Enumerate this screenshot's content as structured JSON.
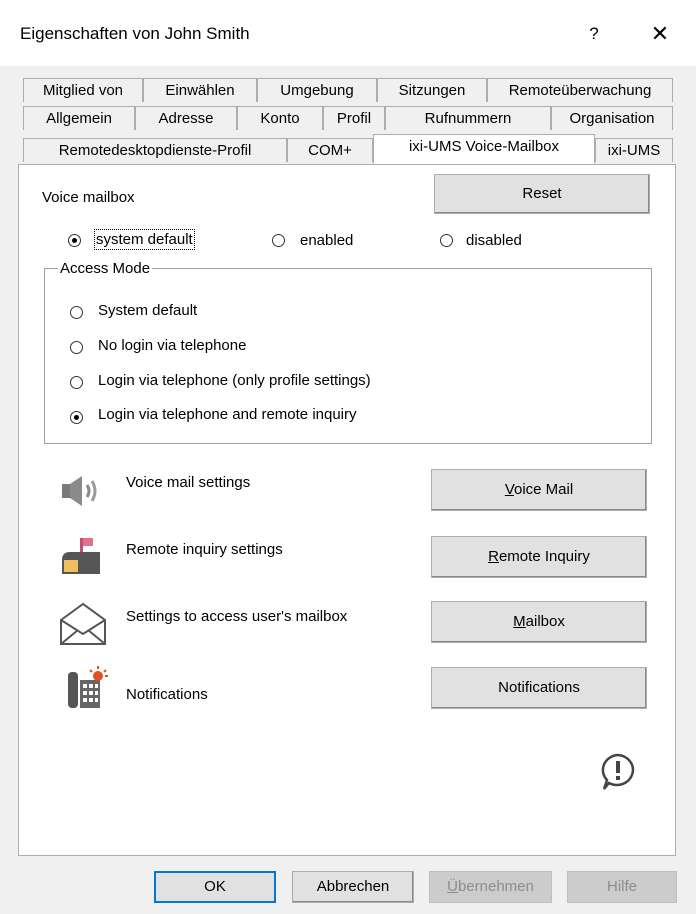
{
  "window": {
    "title": "Eigenschaften von John Smith",
    "help": "?",
    "close": "✕"
  },
  "tabs": {
    "row1": [
      "Mitglied von",
      "Einwählen",
      "Umgebung",
      "Sitzungen",
      "Remoteüberwachung"
    ],
    "row2": [
      "Allgemein",
      "Adresse",
      "Konto",
      "Profil",
      "Rufnummern",
      "Organisation"
    ],
    "row3": [
      "Remotedesktopdienste-Profil",
      "COM+",
      "ixi-UMS Voice-Mailbox",
      "ixi-UMS"
    ],
    "active": "ixi-UMS Voice-Mailbox"
  },
  "voice_mailbox": {
    "label": "Voice mailbox",
    "reset": "Reset",
    "options": [
      "system default",
      "enabled",
      "disabled"
    ],
    "selected": "system default"
  },
  "access_mode": {
    "label": "Access Mode",
    "options": [
      "System default",
      "No login via telephone",
      "Login via telephone (only profile settings)",
      "Login via telephone and remote inquiry"
    ],
    "selected": "Login via telephone and remote inquiry"
  },
  "settings": [
    {
      "label": "Voice mail settings",
      "button_pre": "",
      "button_ul": "V",
      "button_post": "oice Mail",
      "icon": "speaker-icon"
    },
    {
      "label": "Remote inquiry settings",
      "button_pre": "",
      "button_ul": "R",
      "button_post": "emote Inquiry",
      "icon": "mailbox-icon"
    },
    {
      "label": "Settings to access user's mailbox",
      "button_pre": "",
      "button_ul": "M",
      "button_post": "ailbox",
      "icon": "envelope-icon"
    },
    {
      "label": "Notifications",
      "button_pre": "Notifications",
      "button_ul": "",
      "button_post": "",
      "icon": "phone-notification-icon"
    }
  ],
  "footer": {
    "ok": "OK",
    "cancel": "Abbrechen",
    "apply_ul": "Ü",
    "apply_rest": "bernehmen",
    "help": "Hilfe"
  }
}
